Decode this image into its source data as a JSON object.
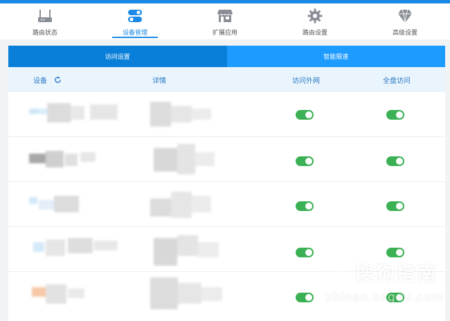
{
  "nav": {
    "items": [
      {
        "label": "路由状态",
        "icon": "router-icon"
      },
      {
        "label": "设备管理",
        "icon": "toggle-switches-icon",
        "active": true
      },
      {
        "label": "扩展应用",
        "icon": "store-icon"
      },
      {
        "label": "路由设置",
        "icon": "gear-icon"
      },
      {
        "label": "高级设置",
        "icon": "diamond-icon"
      }
    ]
  },
  "subtabs": [
    {
      "label": "访问设置",
      "active": true
    },
    {
      "label": "智能限速",
      "active": false
    }
  ],
  "table": {
    "headers": {
      "device": "设备",
      "detail": "详情",
      "external": "访问外网",
      "full": "全盘访问"
    },
    "rows": [
      {
        "external_on": true,
        "full_on": true
      },
      {
        "external_on": true,
        "full_on": true
      },
      {
        "external_on": true,
        "full_on": true
      },
      {
        "external_on": true,
        "full_on": true
      },
      {
        "external_on": true,
        "full_on": true
      }
    ]
  },
  "watermark": {
    "logo_char": "S",
    "text": "搜狗指南",
    "url": "zhinan.sogou.com"
  },
  "colors": {
    "accent": "#1a8ae6",
    "subtab_active": "#0a7fd9",
    "subtab": "#1e9bff",
    "toggle_on": "#3bb054"
  }
}
